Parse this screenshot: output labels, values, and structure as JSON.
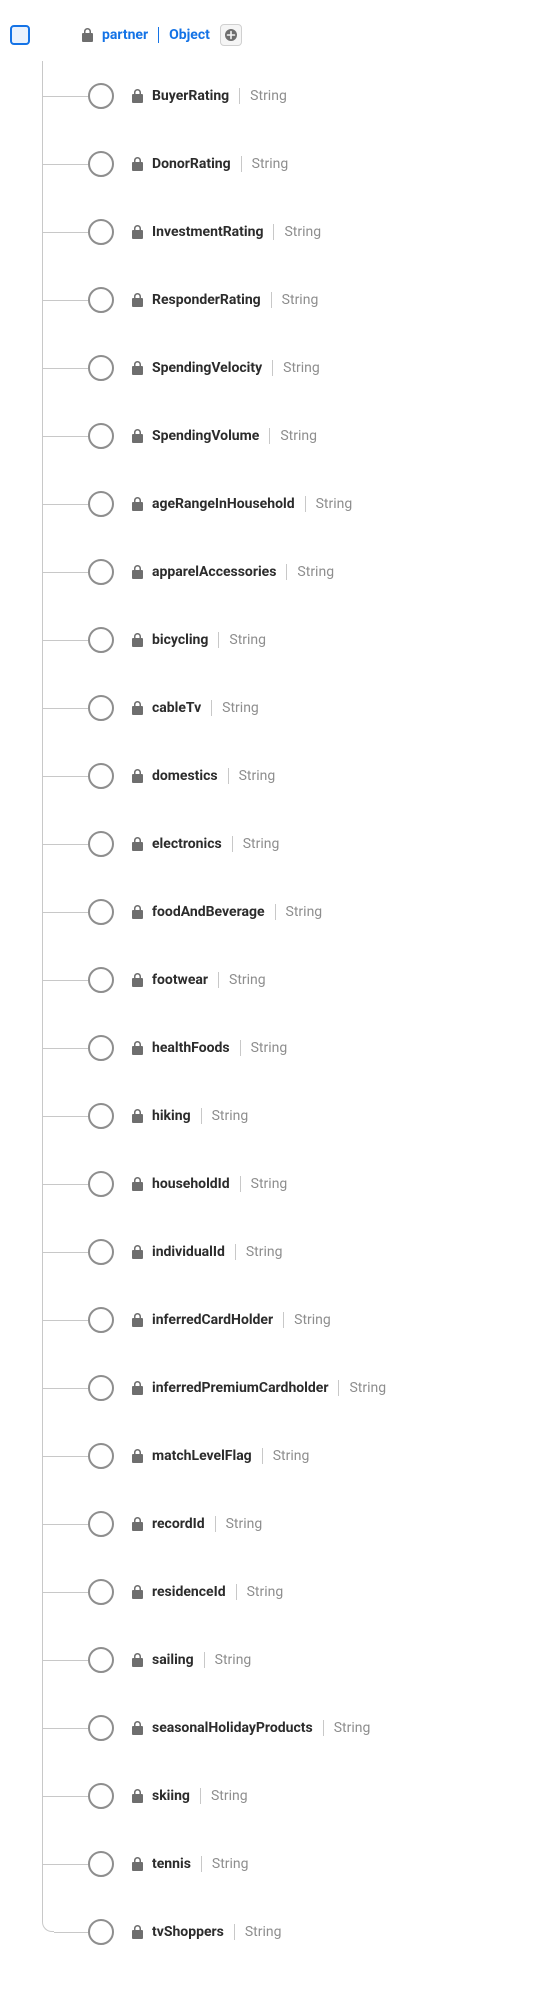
{
  "root": {
    "name": "partner",
    "type": "Object"
  },
  "fields": [
    {
      "name": "BuyerRating",
      "type": "String"
    },
    {
      "name": "DonorRating",
      "type": "String"
    },
    {
      "name": "InvestmentRating",
      "type": "String"
    },
    {
      "name": "ResponderRating",
      "type": "String"
    },
    {
      "name": "SpendingVelocity",
      "type": "String"
    },
    {
      "name": "SpendingVolume",
      "type": "String"
    },
    {
      "name": "ageRangeInHousehold",
      "type": "String"
    },
    {
      "name": "apparelAccessories",
      "type": "String"
    },
    {
      "name": "bicycling",
      "type": "String"
    },
    {
      "name": "cableTv",
      "type": "String"
    },
    {
      "name": "domestics",
      "type": "String"
    },
    {
      "name": "electronics",
      "type": "String"
    },
    {
      "name": "foodAndBeverage",
      "type": "String"
    },
    {
      "name": "footwear",
      "type": "String"
    },
    {
      "name": "healthFoods",
      "type": "String"
    },
    {
      "name": "hiking",
      "type": "String"
    },
    {
      "name": "householdId",
      "type": "String"
    },
    {
      "name": "individualId",
      "type": "String"
    },
    {
      "name": "inferredCardHolder",
      "type": "String"
    },
    {
      "name": "inferredPremiumCardholder",
      "type": "String"
    },
    {
      "name": "matchLevelFlag",
      "type": "String"
    },
    {
      "name": "recordId",
      "type": "String"
    },
    {
      "name": "residenceId",
      "type": "String"
    },
    {
      "name": "sailing",
      "type": "String"
    },
    {
      "name": "seasonalHolidayProducts",
      "type": "String"
    },
    {
      "name": "skiing",
      "type": "String"
    },
    {
      "name": "tennis",
      "type": "String"
    },
    {
      "name": "tvShoppers",
      "type": "String"
    }
  ]
}
